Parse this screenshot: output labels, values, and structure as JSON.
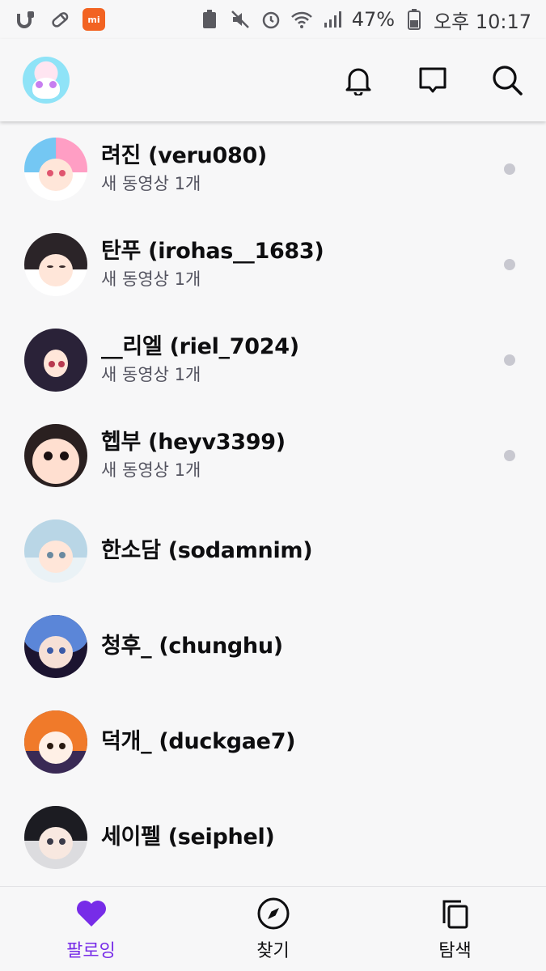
{
  "status_bar": {
    "battery": "47%",
    "time": "오후 10:17"
  },
  "app_bar": {
    "icons": [
      "bell-icon",
      "chat-bubble-icon",
      "search-icon"
    ]
  },
  "colors": {
    "accent": "#772ce8",
    "text": "#0e0e10",
    "subtext": "#53535f",
    "dot": "#c8c8d0",
    "background": "#f7f7f8"
  },
  "following": [
    {
      "name": "려진 (veru080)",
      "subtitle": "새 동영상 1개",
      "unread": true
    },
    {
      "name": "탄푸 (irohas__1683)",
      "subtitle": "새 동영상 1개",
      "unread": true
    },
    {
      "name": "__리엘 (riel_7024)",
      "subtitle": "새 동영상 1개",
      "unread": true
    },
    {
      "name": "헵부 (heyv3399)",
      "subtitle": "새 동영상 1개",
      "unread": true
    },
    {
      "name": "한소담 (sodamnim)",
      "subtitle": "",
      "unread": false
    },
    {
      "name": "청후_ (chunghu)",
      "subtitle": "",
      "unread": false
    },
    {
      "name": "덕개_ (duckgae7)",
      "subtitle": "",
      "unread": false
    },
    {
      "name": "세이펠 (seiphel)",
      "subtitle": "",
      "unread": false
    }
  ],
  "bottom_nav": [
    {
      "label": "팔로잉",
      "icon": "heart-icon",
      "active": true
    },
    {
      "label": "찾기",
      "icon": "compass-icon",
      "active": false
    },
    {
      "label": "탐색",
      "icon": "copy-icon",
      "active": false
    }
  ]
}
